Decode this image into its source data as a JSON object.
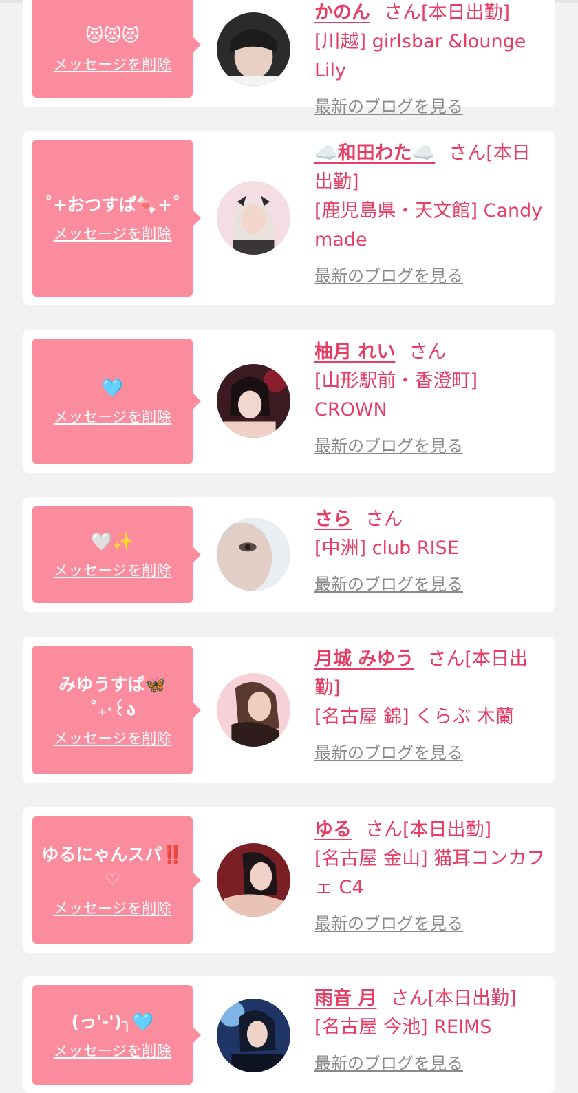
{
  "cards": [
    {
      "message": "😻😻😻",
      "delete_label": "メッセージを削除",
      "name": "かのん",
      "san": "さん",
      "status": "[本日出勤]",
      "shop": "[川越] girlsbar &lounge Lily",
      "blog_label": "最新のブログを見る",
      "avatar_colors": [
        "#2b2b2b",
        "#e7cfc4",
        "#1c1c1c"
      ]
    },
    {
      "message": "˚+おつすぱ🍬+˚",
      "delete_label": "メッセージを削除",
      "name": "☁️和田わた☁️",
      "san": "さん",
      "status": "[本日出勤]",
      "shop": "[鹿児島県・天文館] Candy made",
      "blog_label": "最新のブログを見る",
      "avatar_colors": [
        "#f4dde3",
        "#e9e2dc",
        "#3a3638"
      ]
    },
    {
      "message": "🩵",
      "delete_label": "メッセージを削除",
      "name": "柚月 れい",
      "san": "さん",
      "status": "",
      "shop": "[山形駅前・香澄町] CROWN",
      "blog_label": "最新のブログを見る",
      "avatar_colors": [
        "#3c1a22",
        "#f2d7cf",
        "#8a1e2e"
      ]
    },
    {
      "message": "🤍✨",
      "delete_label": "メッセージを削除",
      "name": "さら",
      "san": "さん",
      "status": "",
      "shop": "[中洲] club RISE",
      "blog_label": "最新のブログを見る",
      "avatar_colors": [
        "#e9eef2",
        "#d9c7c0",
        "#5a4a46"
      ]
    },
    {
      "message": "みゆうすぱ🦋\n˚₊‧꒰ა",
      "delete_label": "メッセージを削除",
      "name": "月城 みゆう",
      "san": "さん",
      "status": "[本日出勤]",
      "shop": "[名古屋 錦] くらぶ 木蘭",
      "blog_label": "最新のブログを見る",
      "avatar_colors": [
        "#f7d1d8",
        "#e7bfae",
        "#4a2a26"
      ]
    },
    {
      "message": "ゆるにゃんスパ‼️\n♡",
      "delete_label": "メッセージを削除",
      "name": "ゆる",
      "san": "さん",
      "status": "[本日出勤]",
      "shop": "[名古屋 金山] 猫耳コンカフェ C4",
      "blog_label": "最新のブログを見る",
      "avatar_colors": [
        "#7a1f24",
        "#f0d3c6",
        "#1d1517"
      ]
    },
    {
      "message": "(っ'-')╮🩵",
      "delete_label": "メッセージを削除",
      "name": "雨音 月",
      "san": "さん",
      "status": "[本日出勤]",
      "shop": "[名古屋 今池] REIMS",
      "blog_label": "最新のブログを見る",
      "avatar_colors": [
        "#1e3566",
        "#7fb4e6",
        "#121a2e"
      ]
    }
  ]
}
